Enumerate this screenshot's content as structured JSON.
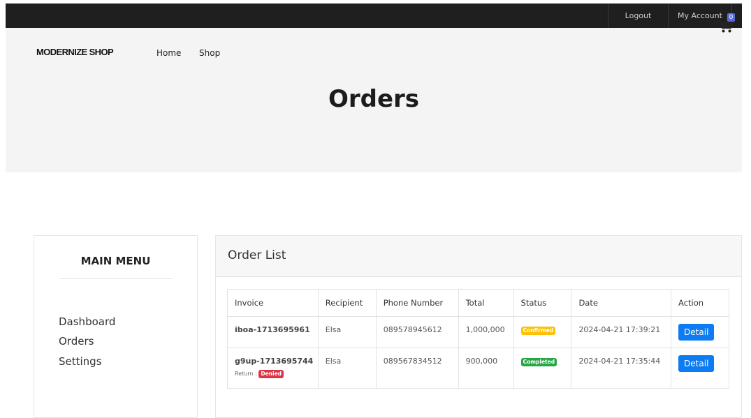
{
  "topbar": {
    "logout": "Logout",
    "my_account": "My Account"
  },
  "header": {
    "logo": "MODERNIZE SHOP",
    "nav": [
      "Home",
      "Shop"
    ],
    "cart_count": "0",
    "page_title": "Orders"
  },
  "sidebar": {
    "title": "MAIN MENU",
    "items": [
      {
        "label": "Dashboard"
      },
      {
        "label": "Orders"
      },
      {
        "label": "Settings"
      }
    ]
  },
  "orders": {
    "title": "Order List",
    "columns": [
      "Invoice",
      "Recipient",
      "Phone Number",
      "Total",
      "Status",
      "Date",
      "Action"
    ],
    "rows": [
      {
        "invoice": "iboa-1713695961",
        "recipient": "Elsa",
        "phone": "089578945612",
        "total": "1,000,000",
        "status": "Confirmed",
        "status_color": "#ffc107",
        "date": "2024-04-21 17:39:21",
        "action": "Detail",
        "return_label": "",
        "return_status": ""
      },
      {
        "invoice": "g9up-1713695744",
        "recipient": "Elsa",
        "phone": "089567834512",
        "total": "900,000",
        "status": "Completed",
        "status_color": "#28a745",
        "date": "2024-04-21 17:35:44",
        "action": "Detail",
        "return_label": "Return :",
        "return_status": "Denied",
        "return_color": "#dc3545"
      }
    ]
  },
  "colors": {
    "topbar": "#1f1f1f",
    "hero": "#f4f4f4",
    "primary_button": "#0d7cf2",
    "cart_badge": "#5a6bd8"
  }
}
